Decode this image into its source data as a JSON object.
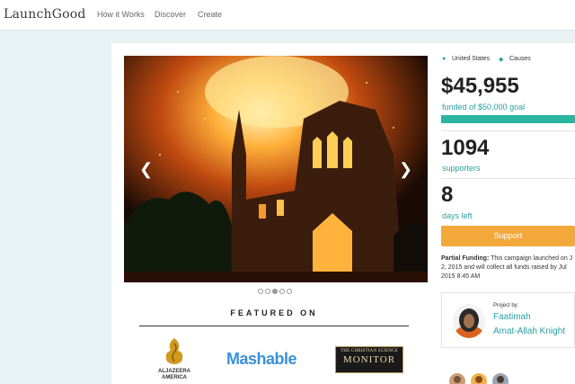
{
  "header": {
    "logo": "LaunchGood",
    "nav": [
      "How it Works",
      "Discover",
      "Create"
    ]
  },
  "carousel": {
    "image_name": "burning-church-photo",
    "prev_icon": "chevron-left-icon",
    "next_icon": "chevron-right-icon",
    "slide_count": 5,
    "active_slide": 3
  },
  "featured": {
    "heading": "FEATURED ON",
    "aljazeera": "ALJAZEERA AMERICA",
    "mashable": "Mashable",
    "csm_top": "THE CHRISTIAN SCIENCE",
    "csm_main": "MONITOR"
  },
  "campaign": {
    "location": "United States",
    "category": "Causes",
    "amount": "$45,955",
    "goal": "funded of $50,000 goal",
    "funded_fraction": 0.92,
    "supporters": "1094",
    "supporters_label": "supporters",
    "days": "8",
    "days_label": "days left",
    "support_button": "Support",
    "partial_label": "Partial Funding:",
    "partial_text": "This campaign launched on J 2, 2015 and will collect all funds raised by Jul 2015 8:45 AM"
  },
  "project": {
    "by_label": "Project by:",
    "name_line1": "Faatimah",
    "name_line2": "Amat-Allah Knight"
  },
  "colors": {
    "accent": "#2a9fa0",
    "progress": "#2bb5a0",
    "button": "#f3a83b",
    "mashable": "#3a8fd8"
  }
}
